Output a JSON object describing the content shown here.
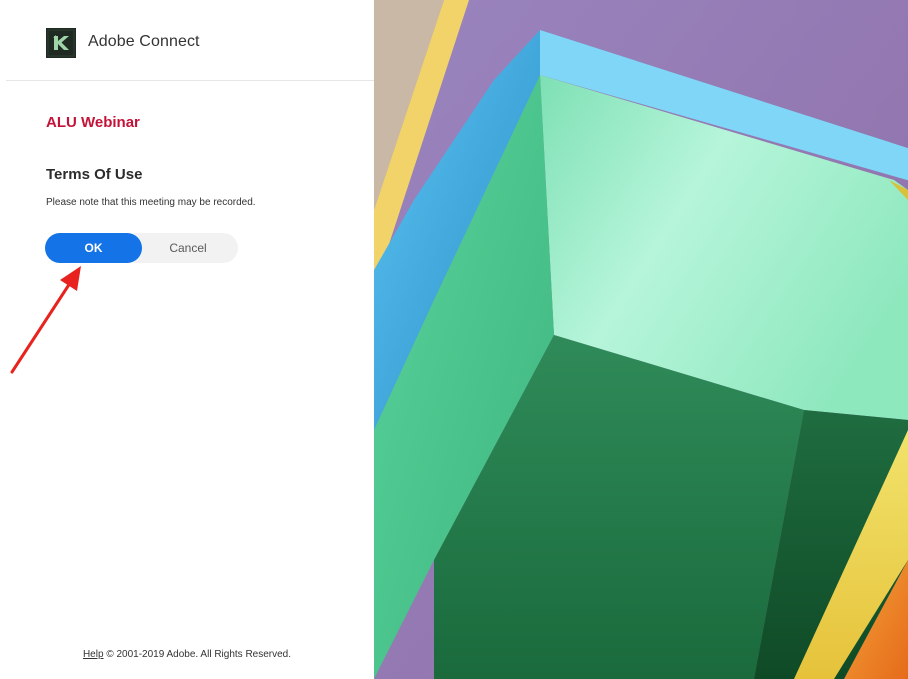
{
  "header": {
    "app_name": "Adobe Connect",
    "logo_icon": "adobe-connect-logo-icon"
  },
  "meeting": {
    "name": "ALU Webinar"
  },
  "terms": {
    "title": "Terms Of Use",
    "text": "Please note that this meeting may be recorded."
  },
  "buttons": {
    "ok_label": "OK",
    "cancel_label": "Cancel"
  },
  "footer": {
    "help_label": "Help",
    "copyright": "© 2001-2019 Adobe. All Rights Reserved."
  },
  "colors": {
    "brand_red": "#c41338",
    "primary_blue": "#1473e6",
    "annotation_red": "#e8231f"
  }
}
